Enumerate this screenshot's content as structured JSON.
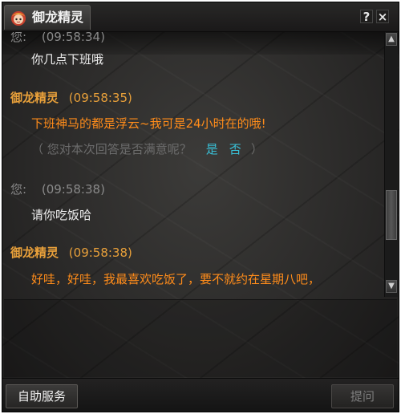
{
  "window": {
    "title": "御龙精灵",
    "help_label": "?",
    "close_label": "×"
  },
  "chat": {
    "messages": [
      {
        "speaker": "您:",
        "time": "(09:58:34)",
        "text": "你几点下班哦"
      },
      {
        "speaker": "御龙精灵",
        "time": "(09:58:35)",
        "text": "下班神马的都是浮云~我可是24小时在的哦!"
      },
      {
        "speaker": "您:",
        "time": "(09:58:38)",
        "text": "请你吃饭哈"
      },
      {
        "speaker": "御龙精灵",
        "time": "(09:58:38)",
        "text": "好哇，好哇，我最喜欢吃饭了，要不就约在星期八吧，"
      }
    ],
    "feedback": {
      "prompt": "（ 您对本次回答是否满意呢？",
      "yes": "是",
      "no": "否",
      "close": "）"
    }
  },
  "buttons": {
    "self_service": "自助服务",
    "submit": "提问"
  },
  "colors": {
    "bot_name": "#e8a03a",
    "bot_message": "#ff8c1a",
    "user_name": "#8a8a8a",
    "feedback_link": "#39c1d8"
  }
}
